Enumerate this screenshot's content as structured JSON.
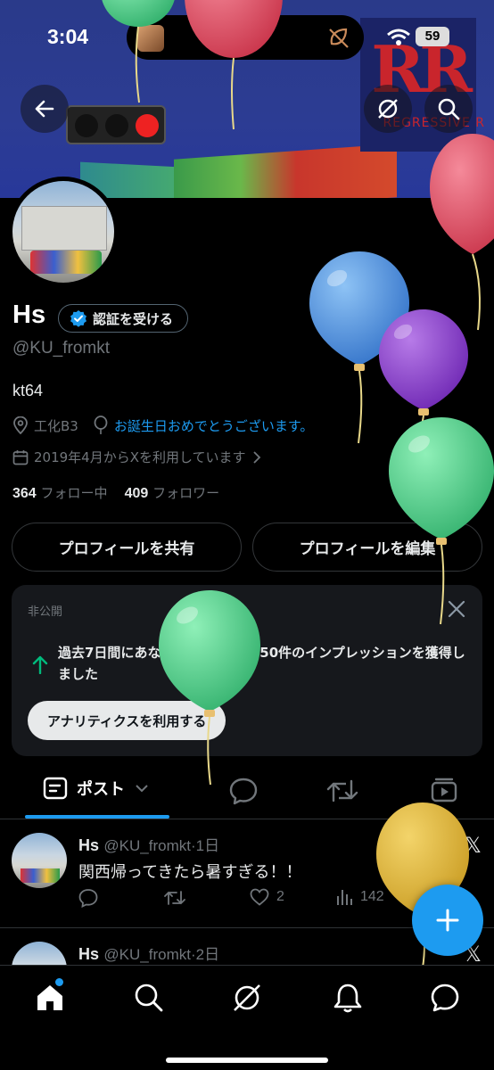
{
  "status_bar": {
    "time": "3:04",
    "battery": "59"
  },
  "banner": {
    "sign_text": "RR",
    "sign_subtext": "REGRESSIVE R"
  },
  "profile": {
    "name": "Hs",
    "verify_label": "認証を受ける",
    "handle": "@KU_fromkt",
    "bio": "kt64",
    "location": "工化B3",
    "birthday": "お誕生日おめでとうございます。",
    "joined": "2019年4月からXを利用しています",
    "following_count": "364",
    "following_label": "フォロー中",
    "followers_count": "409",
    "followers_label": "フォロワー"
  },
  "actions": {
    "share_label": "プロフィールを共有",
    "edit_label": "プロフィールを編集"
  },
  "insight_card": {
    "label": "非公開",
    "message": "過去7日間にあなたのポストは1750件のインプレッションを獲得しました",
    "cta": "アナリティクスを利用する"
  },
  "tabs": {
    "posts_label": "ポスト"
  },
  "posts": [
    {
      "name": "Hs",
      "handle_time": "@KU_fromkt·1日",
      "text": "関西帰ってきたら暑すぎる！！",
      "replies": "",
      "reposts": "",
      "likes": "2",
      "views": "142"
    },
    {
      "name": "Hs",
      "handle_time": "@KU_fromkt·2日"
    }
  ],
  "icons": [
    "back-arrow-icon",
    "grok-icon",
    "search-icon",
    "verified-badge-icon",
    "location-icon",
    "balloon-icon",
    "calendar-icon",
    "chevron-right-icon",
    "close-icon",
    "arrow-up-icon",
    "post-tab-icon",
    "chevron-down-icon",
    "reply-icon",
    "repost-icon",
    "video-icon",
    "like-icon",
    "views-icon",
    "x-logo-icon",
    "plus-icon",
    "home-icon",
    "bell-icon",
    "messages-icon"
  ],
  "colors": {
    "accent": "#1d9bf0",
    "background": "#000000",
    "muted": "#71767b",
    "text": "#e7e9ea"
  }
}
